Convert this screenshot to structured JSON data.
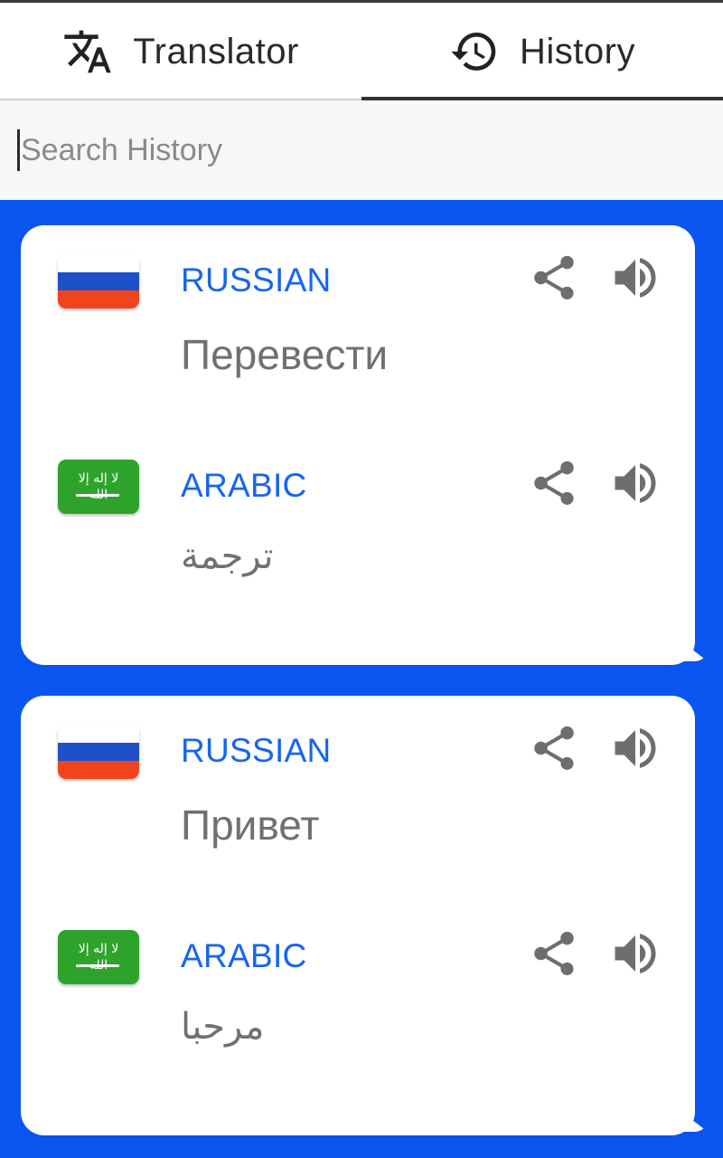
{
  "tabs": [
    {
      "label": "Translator",
      "icon": "translate-icon",
      "active": false
    },
    {
      "label": "History",
      "icon": "history-icon",
      "active": true
    }
  ],
  "search": {
    "placeholder": "Search History",
    "value": ""
  },
  "colors": {
    "background": "#0a55f0",
    "language_label": "#1565f0",
    "text": "#707070",
    "icon": "#6e6e6e"
  },
  "history": [
    {
      "source": {
        "language": "RUSSIAN",
        "flag": "russia-flag",
        "text": "Перевести"
      },
      "target": {
        "language": "ARABIC",
        "flag": "saudi-arabia-flag",
        "text": "ترجمة"
      }
    },
    {
      "source": {
        "language": "RUSSIAN",
        "flag": "russia-flag",
        "text": "Привет"
      },
      "target": {
        "language": "ARABIC",
        "flag": "saudi-arabia-flag",
        "text": "مرحبا"
      }
    }
  ]
}
